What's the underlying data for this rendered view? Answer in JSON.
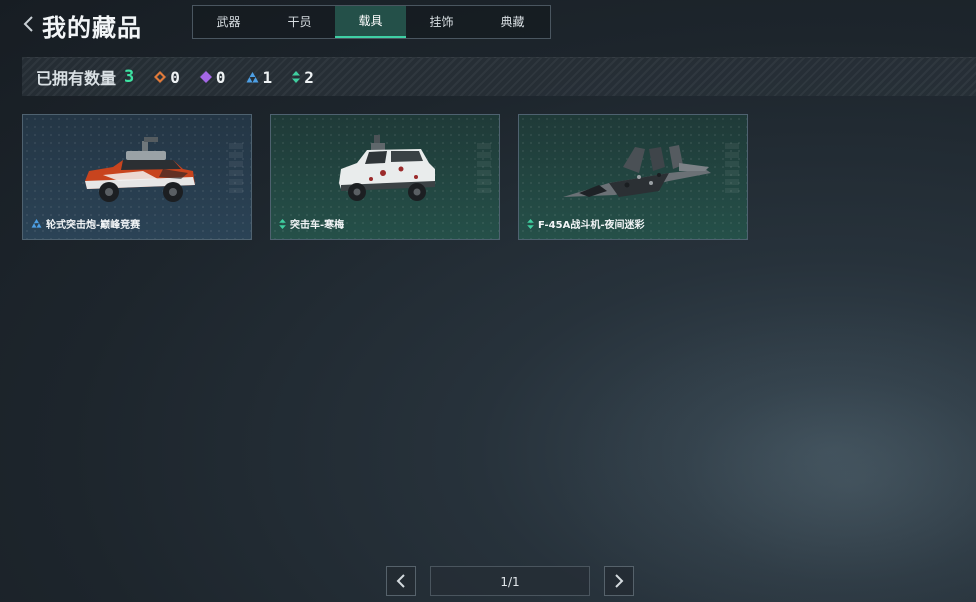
{
  "header": {
    "title": "我的藏品",
    "tabs": [
      {
        "label": "武器",
        "active": false
      },
      {
        "label": "干员",
        "active": false
      },
      {
        "label": "载具",
        "active": true
      },
      {
        "label": "挂饰",
        "active": false
      },
      {
        "label": "典藏",
        "active": false
      }
    ]
  },
  "stats": {
    "owned_label": "已拥有数量",
    "owned_count": "3",
    "rarities": [
      {
        "icon": "orange-diamond-icon",
        "color": "#e07a3a",
        "count": "0"
      },
      {
        "icon": "purple-diamond-icon",
        "color": "#a467e6",
        "count": "0"
      },
      {
        "icon": "blue-triangle-cluster-icon",
        "color": "#4da0e6",
        "count": "1"
      },
      {
        "icon": "green-double-arrow-icon",
        "color": "#3fcfa0",
        "count": "2"
      }
    ]
  },
  "collection": [
    {
      "name": "轮式突击炮-巅峰竞赛",
      "rarity_icon": "blue-triangle-cluster-icon",
      "theme": "blue",
      "image": "red-armored-truck"
    },
    {
      "name": "突击车-寒梅",
      "rarity_icon": "green-double-arrow-icon",
      "theme": "green",
      "image": "white-armored-car"
    },
    {
      "name": "F-45A战斗机-夜间迷彩",
      "rarity_icon": "green-double-arrow-icon",
      "theme": "green",
      "image": "camo-fighter-jet"
    }
  ],
  "pagination": {
    "page": "1/1"
  },
  "colors": {
    "accent": "#3fd0a5",
    "count_green": "#3de3a2"
  }
}
